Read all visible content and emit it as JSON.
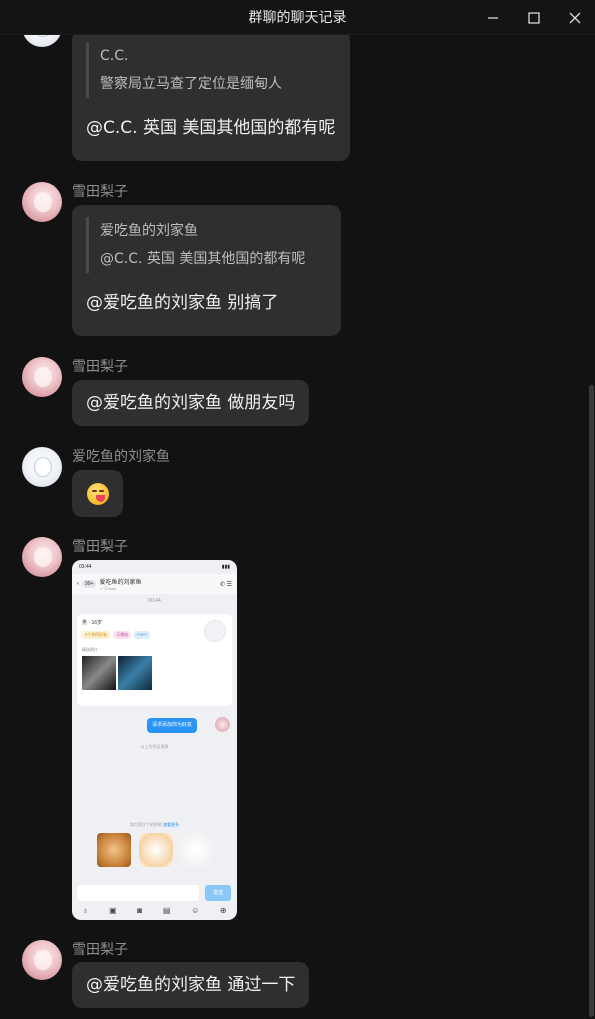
{
  "window": {
    "title": "群聊的聊天记录",
    "minimize_icon": "minimize-icon",
    "maximize_icon": "maximize-icon",
    "close_icon": "close-icon"
  },
  "messages": [
    {
      "quote_name": "C.C.",
      "quote_text": "警察局立马查了定位是缅甸人",
      "reply": "@C.C. 英国 美国其他国的都有呢"
    },
    {
      "sender": "雪田梨子",
      "quote_name": "爱吃鱼的刘家鱼",
      "quote_text": "@C.C. 英国 美国其他国的都有呢",
      "reply": "@爱吃鱼的刘家鱼 别搞了"
    },
    {
      "sender": "雪田梨子",
      "text": "@爱吃鱼的刘家鱼 做朋友吗"
    },
    {
      "sender": "爱吃鱼的刘家鱼",
      "emoji": "yum-face-emoji"
    },
    {
      "sender": "雪田梨子",
      "image": {
        "status_time": "03:44",
        "chat_badge": "99+",
        "chat_name": "爱吃鱼的刘家鱼",
        "chat_sub": "一下Iman",
        "time_label": "00:44",
        "profile_gender_age": "男 · 16岁",
        "tags": [
          "5个共同好友",
          "天蝎座",
          "P1P+"
        ],
        "photos_label": "精选照片",
        "request_text": "请求添加你为好友",
        "note_text": "以上为验证消息",
        "sticker_hint_prefix": "和大家打个招呼吧",
        "sticker_hint_link": "查看更多",
        "send_label": "发送"
      }
    },
    {
      "sender": "雪田梨子",
      "text": "@爱吃鱼的刘家鱼 通过一下"
    }
  ]
}
